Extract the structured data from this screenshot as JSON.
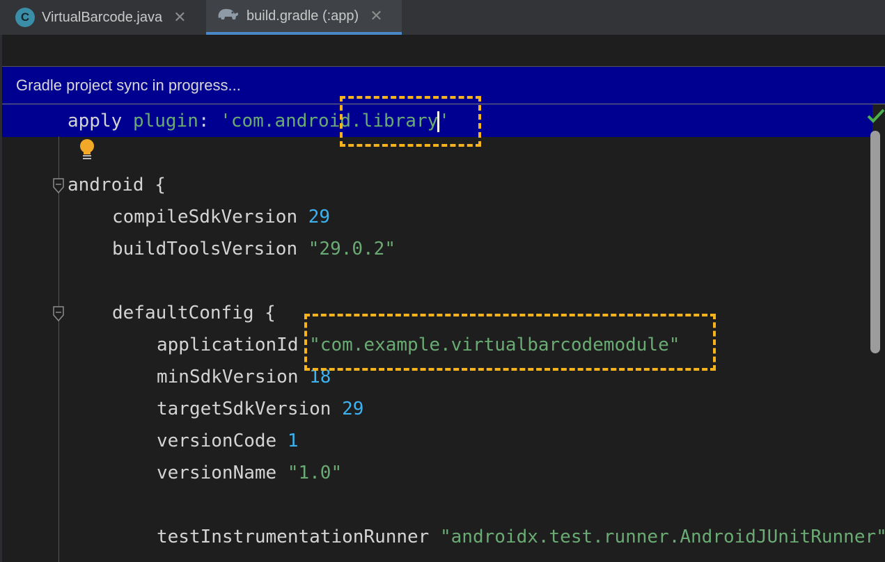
{
  "tabs": [
    {
      "label": "VirtualBarcode.java",
      "icon": "C",
      "active": false
    },
    {
      "label": "build.gradle (:app)",
      "icon": "gradle-elephant-icon",
      "active": true
    }
  ],
  "banner": {
    "text": "Gradle project sync in progress..."
  },
  "code": {
    "line1": {
      "kw": "apply",
      "prop": "plugin",
      "colon": ":",
      "str_a": "'com.andro",
      "str_b": "id.library",
      "str_c": "'"
    },
    "line3": {
      "text": "android {"
    },
    "line4": {
      "key": "compileSdkVersion",
      "val": "29"
    },
    "line5": {
      "key": "buildToolsVersion",
      "val": "\"29.0.2\""
    },
    "line7": {
      "text": "defaultConfig {"
    },
    "line8": {
      "key": "applicationId",
      "val": "\"com.example.virtualbarcodemodule\""
    },
    "line9": {
      "key": "minSdkVersion",
      "val": "18"
    },
    "line10": {
      "key": "targetSdkVersion",
      "val": "29"
    },
    "line11": {
      "key": "versionCode",
      "val": "1"
    },
    "line12": {
      "key": "versionName",
      "val": "\"1.0\""
    },
    "line14": {
      "key": "testInstrumentationRunner",
      "val": "\"androidx.test.runner.AndroidJUnitRunner\""
    }
  },
  "colors": {
    "banner_bg": "#000090",
    "string": "#6aab73",
    "number": "#3db2f0",
    "highlight_box": "#f6b31c",
    "check": "#4caf50"
  }
}
